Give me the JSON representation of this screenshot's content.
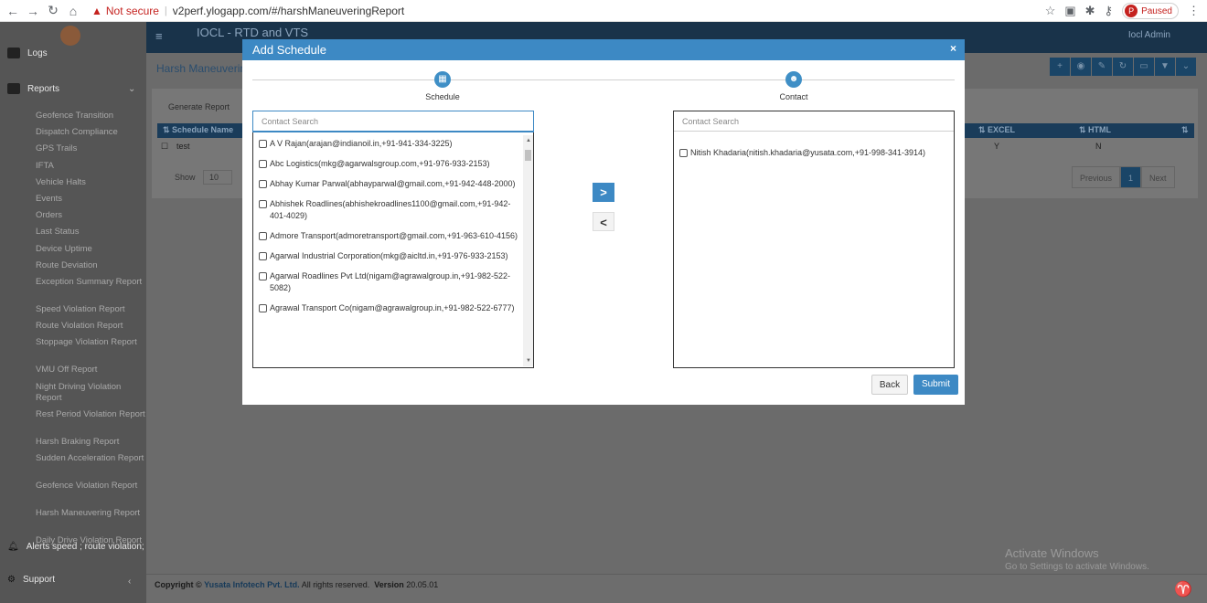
{
  "browser": {
    "url": "v2perf.ylogapp.com/#/harshManeuveringReport",
    "not_secure": "Not secure",
    "profile": "Paused"
  },
  "topbar": {
    "title": "IOCL - RTD and VTS",
    "user": "Iocl Admin"
  },
  "sidebar": {
    "logs": "Logs",
    "reports": "Reports",
    "items": [
      "Geofence Transition",
      "Dispatch Compliance",
      "GPS Trails",
      "IFTA",
      "Vehicle Halts",
      "Events",
      "Orders",
      "Last Status",
      "Device Uptime",
      "Route Deviation",
      "Exception Summary Report",
      "Speed Violation Report",
      "Route Violation Report",
      "Stoppage Violation Report",
      "VMU Off Report",
      "Night Driving Violation Report",
      "Rest Period Violation Report",
      "Harsh Braking Report",
      "Sudden Acceleration Report",
      "Geofence Violation Report",
      "Harsh Maneuvering Report",
      "Daily Drive Violation Report"
    ],
    "alerts": "Alerts speed ; route violation;",
    "support": "Support"
  },
  "page": {
    "title": "Harsh Maneuverin",
    "tab": "Generate Report",
    "columns": [
      "Schedule Name",
      "EXCEL",
      "HTML"
    ],
    "row": {
      "name": "test",
      "excel": "Y",
      "html": "N"
    },
    "show_label": "Show",
    "show_value": "10",
    "pager": {
      "prev": "Previous",
      "current": "1",
      "next": "Next"
    }
  },
  "footer": {
    "copyright": "Copyright ©",
    "company": "Yusata Infotech Pvt. Ltd.",
    "rights": "All rights reserved.",
    "version_label": "Version",
    "version": "20.05.01"
  },
  "windows": {
    "activate": "Activate Windows",
    "hint": "Go to Settings to activate Windows."
  },
  "modal": {
    "title": "Add Schedule",
    "close": "×",
    "steps": [
      "Schedule",
      "Contact"
    ],
    "left_search_placeholder": "Contact Search",
    "right_search_placeholder": "Contact Search",
    "contacts": [
      "A V Rajan(arajan@indianoil.in,+91-941-334-3225)",
      "Abc Logistics(mkg@agarwalsgroup.com,+91-976-933-2153)",
      "Abhay Kumar Parwal(abhayparwal@gmail.com,+91-942-448-2000)",
      "Abhishek Roadlines(abhishekroadlines1100@gmail.com,+91-942-401-4029)",
      "Admore Transport(admoretransport@gmail.com,+91-963-610-4156)",
      "Agarwal Industrial Corporation(mkg@aicltd.in,+91-976-933-2153)",
      "Agarwal Roadlines Pvt Ltd(nigam@agrawalgroup.in,+91-982-522-5082)",
      "Agrawal Transport Co(nigam@agrawalgroup.in,+91-982-522-6777)"
    ],
    "selected": [
      "Nitish Khadaria(nitish.khadaria@yusata.com,+91-998-341-3914)"
    ],
    "move_right": ">",
    "move_left": "<",
    "back": "Back",
    "submit": "Submit",
    "colors": {
      "header": "#3d89c4",
      "submit": "#3d89c4"
    }
  }
}
